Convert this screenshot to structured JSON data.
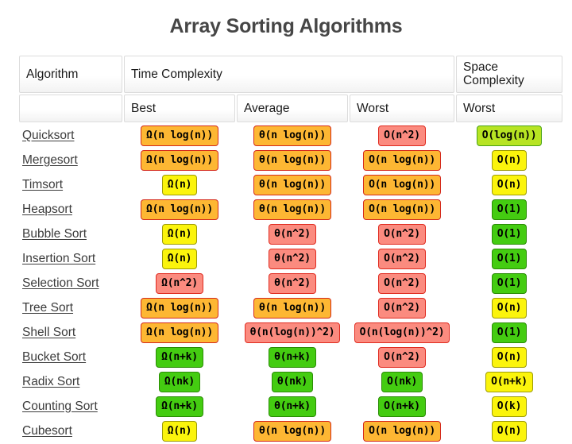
{
  "title": "Array Sorting Algorithms",
  "header": {
    "group_row": {
      "algorithm": "Algorithm",
      "time_complexity": "Time Complexity",
      "space_complexity": "Space Complexity",
      "blank": ""
    },
    "sub_row": {
      "blank": "",
      "best": "Best",
      "average": "Average",
      "worst": "Worst",
      "space_worst": "Worst"
    }
  },
  "colors": {
    "red": "#fb8b7f",
    "red_border": "#e02b20",
    "orange": "#fdb733",
    "orange_border": "#d42a1c",
    "yellow": "#fbf40c",
    "yellow_border": "#9d9b07",
    "chartreuse": "#b7e423",
    "chartreuse_border": "#4aa316",
    "green": "#44cc11",
    "green_border": "#2a8c05",
    "title": "#464646",
    "link": "#3c3c3c"
  },
  "rows": [
    {
      "algorithm": "Quicksort",
      "best": {
        "text": "Ω(n log(n))",
        "color": "orange"
      },
      "average": {
        "text": "θ(n log(n))",
        "color": "orange"
      },
      "worst": {
        "text": "O(n^2)",
        "color": "red"
      },
      "space": {
        "text": "O(log(n))",
        "color": "chartreuse"
      }
    },
    {
      "algorithm": "Mergesort",
      "best": {
        "text": "Ω(n log(n))",
        "color": "orange"
      },
      "average": {
        "text": "θ(n log(n))",
        "color": "orange"
      },
      "worst": {
        "text": "O(n log(n))",
        "color": "orange"
      },
      "space": {
        "text": "O(n)",
        "color": "yellow"
      }
    },
    {
      "algorithm": "Timsort",
      "best": {
        "text": "Ω(n)",
        "color": "yellow"
      },
      "average": {
        "text": "θ(n log(n))",
        "color": "orange"
      },
      "worst": {
        "text": "O(n log(n))",
        "color": "orange"
      },
      "space": {
        "text": "O(n)",
        "color": "yellow"
      }
    },
    {
      "algorithm": "Heapsort",
      "best": {
        "text": "Ω(n log(n))",
        "color": "orange"
      },
      "average": {
        "text": "θ(n log(n))",
        "color": "orange"
      },
      "worst": {
        "text": "O(n log(n))",
        "color": "orange"
      },
      "space": {
        "text": "O(1)",
        "color": "green"
      }
    },
    {
      "algorithm": "Bubble Sort",
      "best": {
        "text": "Ω(n)",
        "color": "yellow"
      },
      "average": {
        "text": "θ(n^2)",
        "color": "red"
      },
      "worst": {
        "text": "O(n^2)",
        "color": "red"
      },
      "space": {
        "text": "O(1)",
        "color": "green"
      }
    },
    {
      "algorithm": "Insertion Sort",
      "best": {
        "text": "Ω(n)",
        "color": "yellow"
      },
      "average": {
        "text": "θ(n^2)",
        "color": "red"
      },
      "worst": {
        "text": "O(n^2)",
        "color": "red"
      },
      "space": {
        "text": "O(1)",
        "color": "green"
      }
    },
    {
      "algorithm": "Selection Sort",
      "best": {
        "text": "Ω(n^2)",
        "color": "red"
      },
      "average": {
        "text": "θ(n^2)",
        "color": "red"
      },
      "worst": {
        "text": "O(n^2)",
        "color": "red"
      },
      "space": {
        "text": "O(1)",
        "color": "green"
      }
    },
    {
      "algorithm": "Tree Sort",
      "best": {
        "text": "Ω(n log(n))",
        "color": "orange"
      },
      "average": {
        "text": "θ(n log(n))",
        "color": "orange"
      },
      "worst": {
        "text": "O(n^2)",
        "color": "red"
      },
      "space": {
        "text": "O(n)",
        "color": "yellow"
      }
    },
    {
      "algorithm": "Shell Sort",
      "best": {
        "text": "Ω(n log(n))",
        "color": "orange"
      },
      "average": {
        "text": "θ(n(log(n))^2)",
        "color": "red"
      },
      "worst": {
        "text": "O(n(log(n))^2)",
        "color": "red"
      },
      "space": {
        "text": "O(1)",
        "color": "green"
      }
    },
    {
      "algorithm": "Bucket Sort",
      "best": {
        "text": "Ω(n+k)",
        "color": "green"
      },
      "average": {
        "text": "θ(n+k)",
        "color": "green"
      },
      "worst": {
        "text": "O(n^2)",
        "color": "red"
      },
      "space": {
        "text": "O(n)",
        "color": "yellow"
      }
    },
    {
      "algorithm": "Radix Sort",
      "best": {
        "text": "Ω(nk)",
        "color": "green"
      },
      "average": {
        "text": "θ(nk)",
        "color": "green"
      },
      "worst": {
        "text": "O(nk)",
        "color": "green"
      },
      "space": {
        "text": "O(n+k)",
        "color": "yellow"
      }
    },
    {
      "algorithm": "Counting Sort",
      "best": {
        "text": "Ω(n+k)",
        "color": "green"
      },
      "average": {
        "text": "θ(n+k)",
        "color": "green"
      },
      "worst": {
        "text": "O(n+k)",
        "color": "green"
      },
      "space": {
        "text": "O(k)",
        "color": "yellow"
      }
    },
    {
      "algorithm": "Cubesort",
      "best": {
        "text": "Ω(n)",
        "color": "yellow"
      },
      "average": {
        "text": "θ(n log(n))",
        "color": "orange"
      },
      "worst": {
        "text": "O(n log(n))",
        "color": "orange"
      },
      "space": {
        "text": "O(n)",
        "color": "yellow"
      }
    }
  ]
}
